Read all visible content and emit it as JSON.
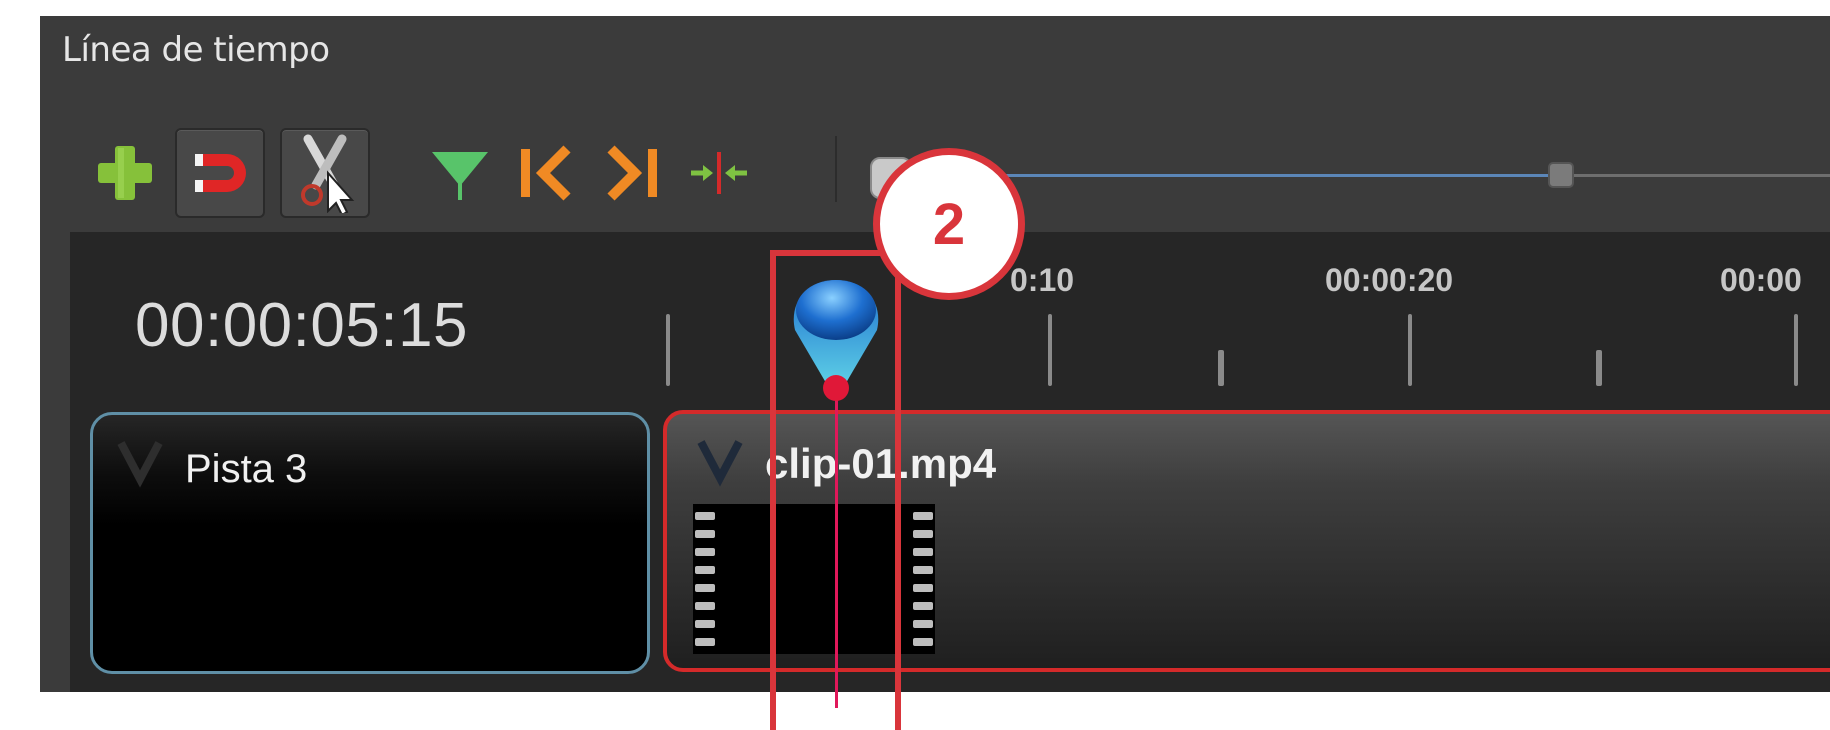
{
  "panel": {
    "title": "Línea de tiempo"
  },
  "toolbar": {
    "buttons": [
      {
        "name": "add-track-button",
        "icon": "plus-icon",
        "color": "#86c13a"
      },
      {
        "name": "snapping-toggle",
        "icon": "magnet-icon",
        "color": "#e02626"
      },
      {
        "name": "razor-toggle",
        "icon": "scissors-icon",
        "color": "#cfcfcf"
      },
      {
        "name": "add-marker-button",
        "icon": "marker-triangle-icon",
        "color": "#58c46a"
      },
      {
        "name": "previous-marker-button",
        "icon": "jump-start-icon",
        "color": "#f08a24"
      },
      {
        "name": "next-marker-button",
        "icon": "jump-end-icon",
        "color": "#f08a24"
      },
      {
        "name": "center-playhead-button",
        "icon": "center-arrows-icon",
        "color": "#7fc242"
      }
    ]
  },
  "timeline": {
    "timecode": "00:00:05:15",
    "ruler_labels": [
      "0:10",
      "00:00:20",
      "00:00"
    ],
    "accent_color": "#d42a2a"
  },
  "track": {
    "name": "Pista 3"
  },
  "clip": {
    "name": "clip-01.mp4"
  },
  "callout": {
    "number": "2",
    "color": "#d9353b"
  }
}
